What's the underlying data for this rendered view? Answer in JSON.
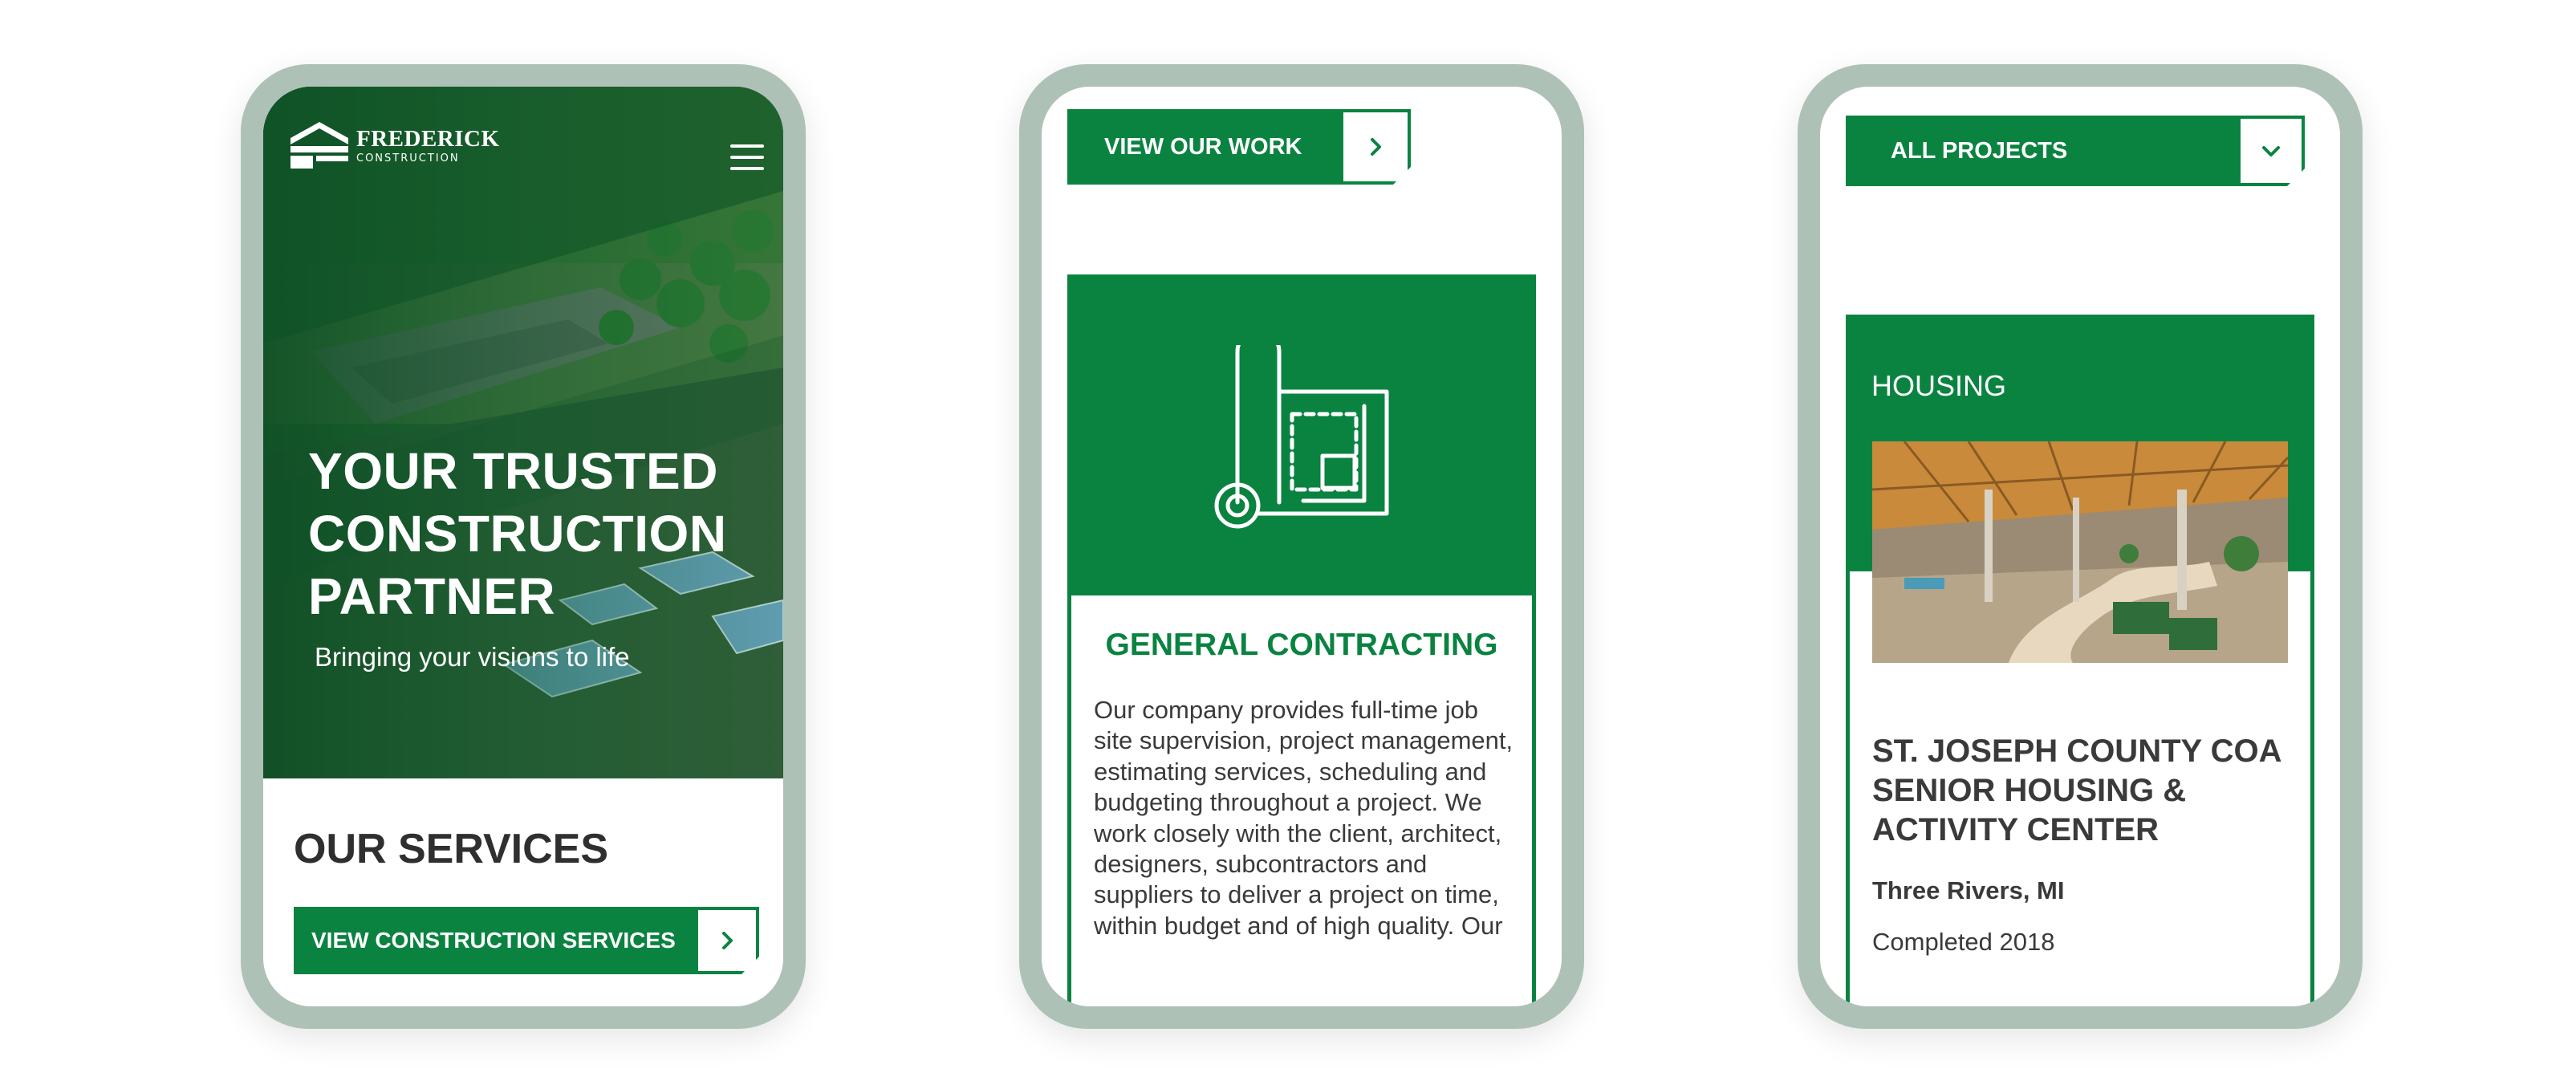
{
  "phone1": {
    "logo": {
      "name": "FREDERICK",
      "sub": "CONSTRUCTION"
    },
    "hero": {
      "title_lines": [
        "YOUR TRUSTED",
        "CONSTRUCTION",
        "PARTNER"
      ],
      "subtitle": "Bringing your visions to life"
    },
    "services": {
      "heading": "OUR SERVICES",
      "button_label": "VIEW CONSTRUCTION SERVICES"
    }
  },
  "phone2": {
    "button_label": "VIEW OUR WORK",
    "card": {
      "icon": "blueprint-icon",
      "title": "GENERAL CONTRACTING",
      "body": "Our company provides full-time job site supervision, project management, estimating services, scheduling and budgeting throughout a project. We work closely with the client, architect, designers, subcontractors and suppliers to deliver a project on time, within budget and of high quality. Our"
    }
  },
  "phone3": {
    "dropdown_label": "ALL PROJECTS",
    "card": {
      "category": "HOUSING",
      "title": "ST. JOSEPH COUNTY COA SENIOR HOUSING & ACTIVITY CENTER",
      "location": "Three Rivers, MI",
      "status": "Completed 2018"
    }
  },
  "colors": {
    "brand_green": "#0a8341",
    "phone_frame": "#aec1b6",
    "text_dark": "#3a3a3a"
  },
  "icons": [
    "logo-mark-icon",
    "hamburger-menu-icon",
    "chevron-right-icon",
    "blueprint-icon",
    "chevron-down-icon"
  ]
}
